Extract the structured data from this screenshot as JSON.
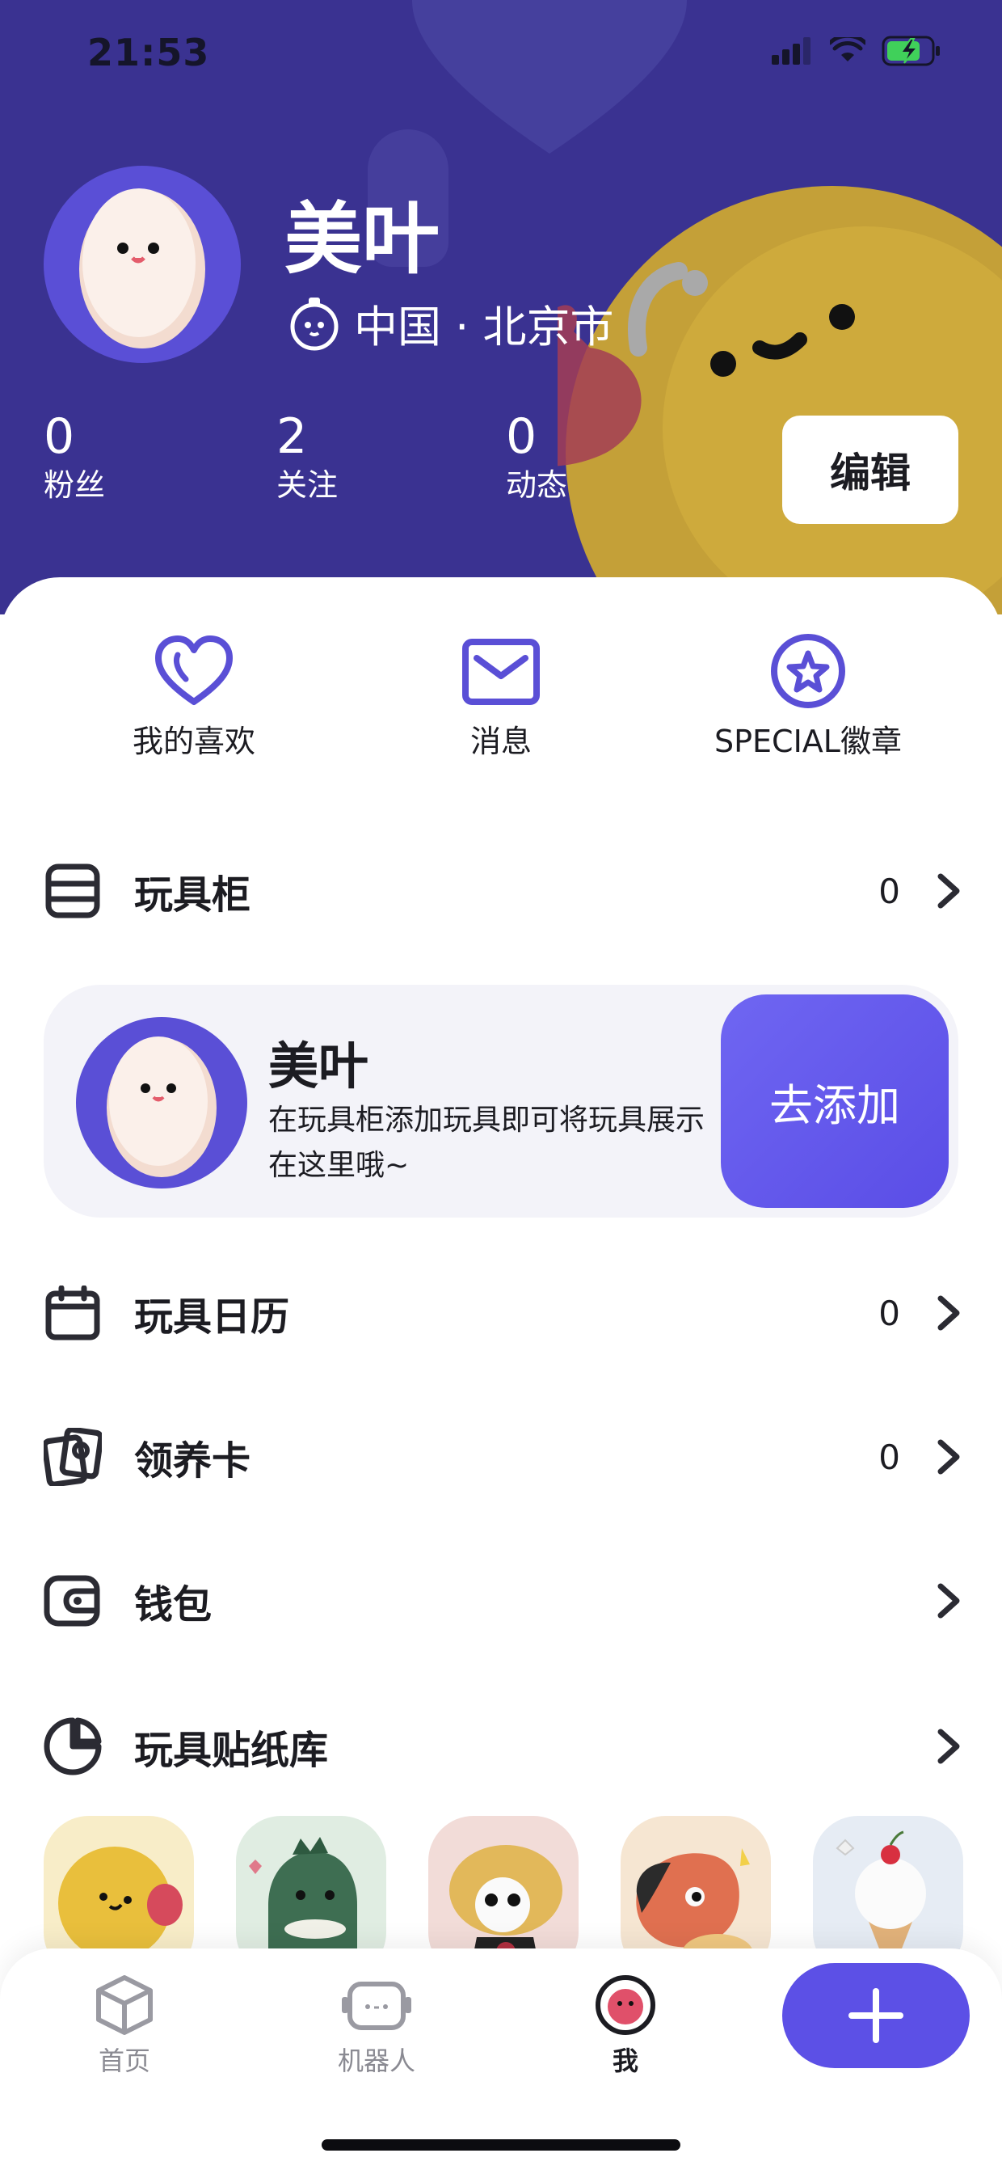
{
  "status_bar": {
    "time": "21:53"
  },
  "profile": {
    "name": "美叶",
    "location": "中国 · 北京市",
    "stats": [
      {
        "value": "0",
        "label": "粉丝"
      },
      {
        "value": "2",
        "label": "关注"
      },
      {
        "value": "0",
        "label": "动态"
      }
    ],
    "edit_label": "编辑"
  },
  "quick_actions": [
    {
      "icon": "heart-icon",
      "label": "我的喜欢"
    },
    {
      "icon": "mail-icon",
      "label": "消息"
    },
    {
      "icon": "star-badge-icon",
      "label": "SPECIAL徽章"
    }
  ],
  "menu": {
    "toy_cabinet": {
      "label": "玩具柜",
      "count": "0"
    },
    "toy_calendar": {
      "label": "玩具日历",
      "count": "0"
    },
    "adoption_card": {
      "label": "领养卡",
      "count": "0"
    },
    "wallet": {
      "label": "钱包"
    },
    "sticker_library": {
      "label": "玩具贴纸库"
    }
  },
  "toy_card": {
    "name": "美叶",
    "description": "在玩具柜添加玩具即可将玩具展示在这里哦~",
    "add_label": "去添加"
  },
  "tabbar": {
    "tabs": [
      {
        "label": "首页"
      },
      {
        "label": "机器人"
      },
      {
        "label": "我"
      }
    ]
  },
  "colors": {
    "header_bg": "#3a3291",
    "accent": "#5c50e6",
    "icon_purple": "#5a4fd6"
  }
}
